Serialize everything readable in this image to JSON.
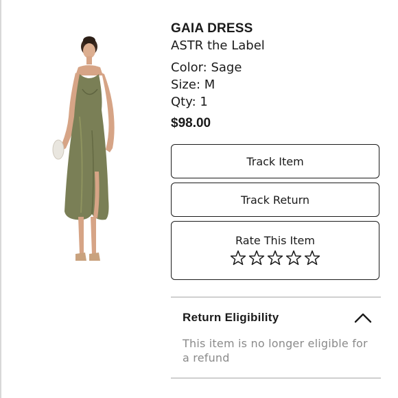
{
  "product": {
    "name": "GAIA DRESS",
    "brand": "ASTR the Label",
    "color": "Color: Sage",
    "size": "Size: M",
    "qty": "Qty: 1",
    "price": "$98.00",
    "image_alt": "olive-green-satin-midi-dress-on-model",
    "colors": {
      "dress": "#7a7f56",
      "skin": "#d9a88a"
    }
  },
  "actions": {
    "track_item": "Track Item",
    "track_return": "Track Return",
    "rate_item": "Rate This Item",
    "rating": 0,
    "max_rating": 5
  },
  "return_eligibility": {
    "title": "Return Eligibility",
    "expanded": true,
    "message": "This item is no longer eligible for a refund"
  }
}
